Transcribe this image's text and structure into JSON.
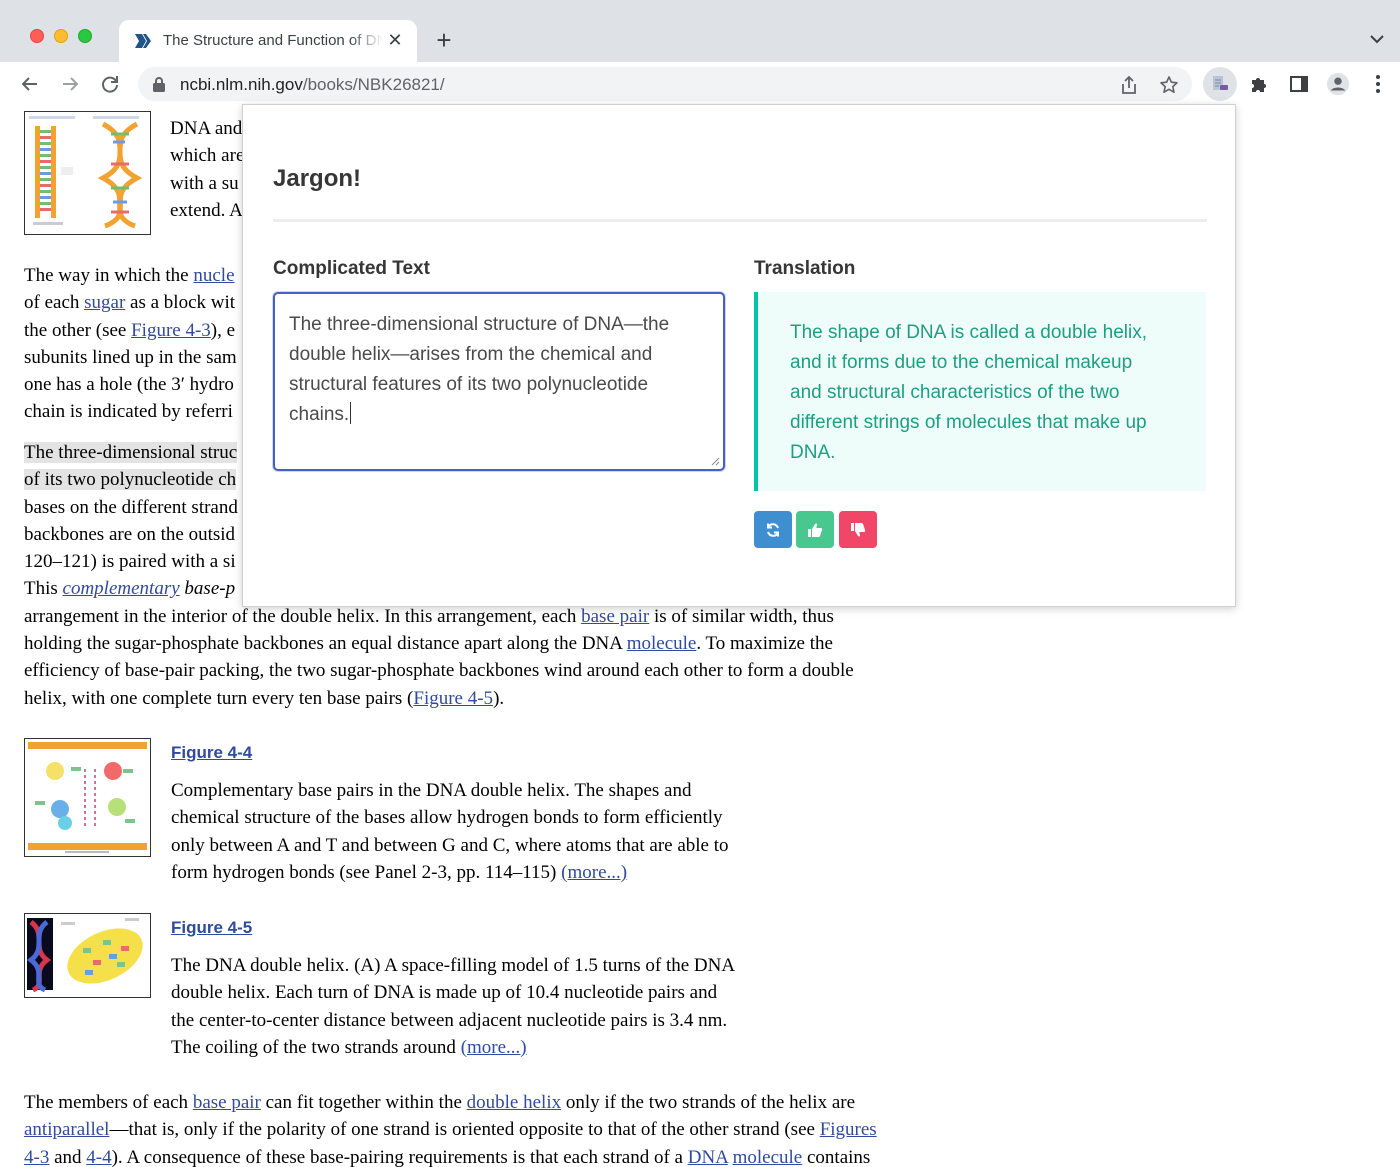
{
  "browser": {
    "tab_title": "The Structure and Function of DNA",
    "tab_close": "✕",
    "new_tab": "+",
    "url_host": "ncbi.nlm.nih.gov",
    "url_path": "/books/NBK26821/"
  },
  "page": {
    "intro_lines": [
      "DNA and",
      "which are",
      "with a su",
      "extend. A"
    ],
    "para1": {
      "l1_pre": "The way in which the ",
      "l1_link": "nucle",
      "l2_pre": "of each ",
      "l2_link": "sugar",
      "l2_post": " as a block wit",
      "l3_pre": "the other (see ",
      "l3_link": "Figure 4-3",
      "l3_post": "), e",
      "l4": "subunits lined up in the sam",
      "l5": "one has a hole (the 3′ hydro",
      "l6": "chain is indicated by referri"
    },
    "para2": {
      "l1": "The three-dimensional struc",
      "l2": "of its two polynucleotide ch",
      "l3": "bases on the different strand",
      "l4": "backbones are on the outsid",
      "l5": "120–121) is paired with a si",
      "l6_pre": "This ",
      "l6_link": "complementary",
      "l6_post": " base-p",
      "l7_pre": "arrangement in the interior of the double helix. In this arrangement, each ",
      "l7_link": "base pair",
      "l7_post": " is of similar width, thus",
      "l8_pre": "holding the sugar-phosphate backbones an equal distance apart along the DNA ",
      "l8_link": "molecule",
      "l8_post": ". To maximize the",
      "l9": "efficiency of base-pair packing, the two sugar-phosphate backbones wind around each other to form a double",
      "l10_pre": "helix, with one complete turn every ten base pairs (",
      "l10_link": "Figure 4-5",
      "l10_post": ")."
    },
    "figure44": {
      "link": "Figure 4-4",
      "lines": [
        "Complementary base pairs in the DNA double helix. The shapes and",
        "chemical structure of the bases allow hydrogen bonds to form efficiently",
        "only between A and T and between G and C, where atoms that are able to",
        "form hydrogen bonds (see Panel 2-3, pp. 114–115) "
      ],
      "more": "(more...)"
    },
    "figure45": {
      "link": "Figure 4-5",
      "lines": [
        "The DNA double helix. (A) A space-filling model of 1.5 turns of the DNA",
        "double helix. Each turn of DNA is made up of 10.4 nucleotide pairs and",
        "the center-to-center distance between adjacent nucleotide pairs is 3.4 nm.",
        "The coiling of the two strands around "
      ],
      "more": "(more...)"
    },
    "para3": {
      "l1_pre": "The members of each ",
      "l1_link1": "base pair",
      "l1_mid": " can fit together within the ",
      "l1_link2": "double helix",
      "l1_post": " only if the two strands of the helix are",
      "l2_link1": "antiparallel",
      "l2_mid": "—that is, only if the polarity of one strand is oriented opposite to that of the other strand (see ",
      "l2_link2": "Figures",
      "l3_link1": "4-3",
      "l3_mid": " and ",
      "l3_link2": "4-4",
      "l3_mid2": "). A consequence of these base-pairing requirements is that each strand of a ",
      "l3_link3": "DNA",
      "l3_space": " ",
      "l3_link4": "molecule",
      "l3_post": " contains"
    }
  },
  "popup": {
    "title": "Jargon!",
    "input_label": "Complicated Text",
    "input_value": "The three-dimensional structure of DNA—the double helix—arises from the chemical and structural features of its two polynucleotide chains.",
    "output_label": "Translation",
    "output_lines": [
      "The shape of DNA is called a double helix,",
      "and it forms due to the chemical makeup",
      "and structural characteristics of the two",
      "different strings of molecules that make up",
      "DNA."
    ],
    "colors": {
      "primary": "#485fc7",
      "refresh": "#3e8ed0",
      "up": "#48c78e",
      "down": "#f14668",
      "translation_text": "#1f9e82",
      "translation_bg": "#effdfa"
    },
    "icons": [
      "refresh-icon",
      "thumbs-up-icon",
      "thumbs-down-icon"
    ]
  }
}
